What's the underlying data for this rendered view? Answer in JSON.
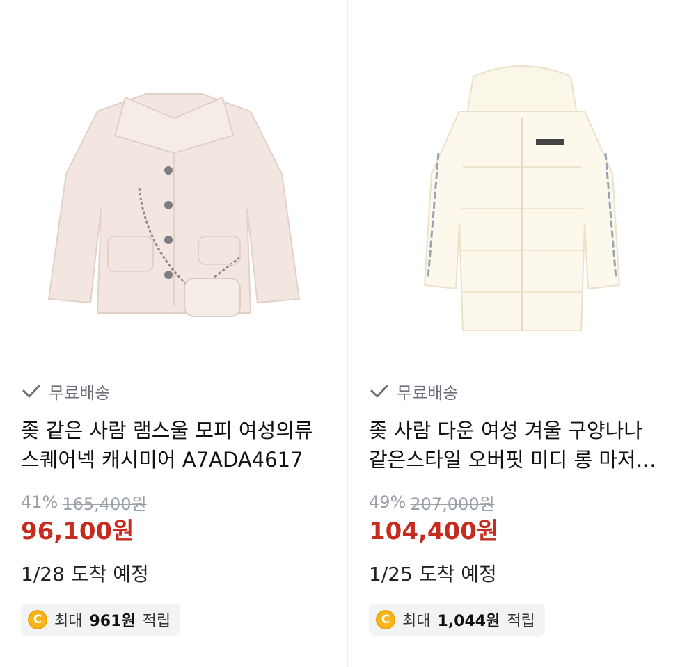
{
  "products": [
    {
      "image_alt": "lamb wool jacket",
      "shipping_label": "무료배송",
      "title": "좆 같은 사람 램스울 모피 여성의류 스퀘어넥 캐시미어 A7ADA4617",
      "discount": "41%",
      "original_price": "165,400원",
      "sale_price": "96,100원",
      "arrival": "1/28 도착 예정",
      "points_prefix": "최대",
      "points_amount": "961원",
      "points_suffix": "적립",
      "coin_icon_letter": "C"
    },
    {
      "image_alt": "white padded coat",
      "shipping_label": "무료배송",
      "title": "좆 사람 다운 여성 겨울 구양나나 같은스타일 오버핏 미디 롱 마저…",
      "discount": "49%",
      "original_price": "207,000원",
      "sale_price": "104,400원",
      "arrival": "1/25 도착 예정",
      "points_prefix": "최대",
      "points_amount": "1,044원",
      "points_suffix": "적립",
      "coin_icon_letter": "C"
    }
  ],
  "colors": {
    "sale": "#c52b1f",
    "muted": "#9aa0a7",
    "coin": "#f5b51b"
  }
}
